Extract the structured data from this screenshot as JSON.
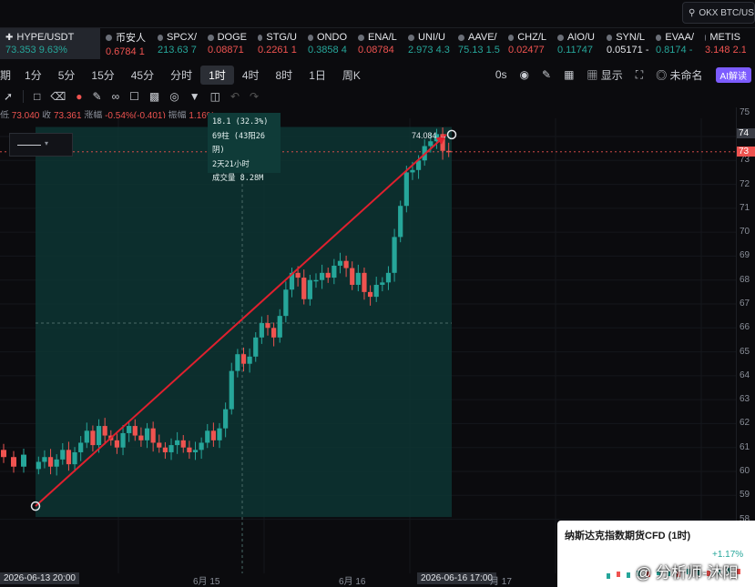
{
  "search": {
    "text": "OKX BTC/USDT"
  },
  "main_ticker": {
    "name": "HYPE/USDT",
    "price": "73.353",
    "change": "9.63%"
  },
  "tickers": [
    {
      "name": "币安人",
      "price": "0.6784",
      "change": "1",
      "dir": "dn"
    },
    {
      "name": "SPCX/",
      "price": "213.63",
      "change": "7",
      "dir": "up"
    },
    {
      "name": "DOGE",
      "price": "0.08871",
      "change": "",
      "dir": "dn"
    },
    {
      "name": "STG/U",
      "price": "0.2261",
      "change": "1",
      "dir": "dn"
    },
    {
      "name": "ONDO",
      "price": "0.3858",
      "change": "4",
      "dir": "up"
    },
    {
      "name": "ENA/L",
      "price": "0.08784",
      "change": "",
      "dir": "dn"
    },
    {
      "name": "UNI/U",
      "price": "2.973",
      "change": "4.3",
      "dir": "up"
    },
    {
      "name": "AAVE/",
      "price": "75.13",
      "change": "1.5",
      "dir": "up"
    },
    {
      "name": "CHZ/L",
      "price": "0.02477",
      "change": "",
      "dir": "dn"
    },
    {
      "name": "AIO/U",
      "price": "0.11747",
      "change": "",
      "dir": "up"
    },
    {
      "name": "SYN/L",
      "price": "0.05171",
      "change": "-",
      "dir": "neutral"
    },
    {
      "name": "EVAA/",
      "price": "0.8174",
      "change": "-",
      "dir": "up"
    },
    {
      "name": "METIS",
      "price": "3.148",
      "change": "2.1",
      "dir": "dn"
    }
  ],
  "intervals": {
    "cut": "期",
    "items": [
      "1分",
      "5分",
      "15分",
      "45分",
      "分时",
      "1时",
      "4时",
      "8时",
      "1日",
      "周K"
    ],
    "active": "1时"
  },
  "toolbar_right": {
    "zero": "0s",
    "show": "显示",
    "unnamed": "未命名",
    "ai": "AI解读"
  },
  "ohlc": {
    "low_label": "低",
    "low": "73.040",
    "close_label": "收",
    "close": "73.361",
    "chg_label": "涨幅",
    "chg": "-0.54%(-0.401)",
    "amp_label": "振幅",
    "amp": "1.16%"
  },
  "measure": {
    "line1": "18.1 (32.3%)",
    "line2": "69柱 (43阳26阴)",
    "line3": "2天21小时",
    "line4": "成交量 8.28M",
    "end_price": "74.084"
  },
  "x_axis": {
    "start": "2026-06-13 20:00",
    "t1": "6月 15",
    "t2": "6月 16",
    "end": "2026-06-16 17:00",
    "t3": "月 17"
  },
  "y_axis": {
    "ticks": [
      "75",
      "74",
      "73",
      "72",
      "71",
      "70",
      "69",
      "68",
      "67",
      "66",
      "65",
      "64",
      "63",
      "62",
      "61",
      "60",
      "59",
      "58"
    ],
    "price_tag_1": "74",
    "price_tag_2": "73"
  },
  "mini_panel": {
    "title": "纳斯达克指数期货CFD (1时)",
    "change": "+1.17%",
    "watermark": "@ 分析师-沐阳"
  },
  "colors": {
    "up": "#26a69a",
    "down": "#ef5350",
    "band": "#0d3532",
    "arrow": "#e0202e",
    "accent": "#7c5cff"
  },
  "chart_data": {
    "type": "candlestick",
    "interval": "1时",
    "ylim": [
      58,
      75.5
    ],
    "closes": [
      60.4,
      60.6,
      60.2,
      60.5,
      60.9,
      60.3,
      60.8,
      61.2,
      61.7,
      61.1,
      61.9,
      61.5,
      61.3,
      61.0,
      61.6,
      61.9,
      61.5,
      61.3,
      61.8,
      61.2,
      61.0,
      60.8,
      61.1,
      61.3,
      61.0,
      60.8,
      60.9,
      61.2,
      61.7,
      61.3,
      61.8,
      62.6,
      64.2,
      64.9,
      64.5,
      64.8,
      65.6,
      66.2,
      66.0,
      65.6,
      66.5,
      67.6,
      68.3,
      68.1,
      67.2,
      68.0,
      68.0,
      68.3,
      68.1,
      68.6,
      68.8,
      68.5,
      67.8,
      68.3,
      67.5,
      67.3,
      67.8,
      67.9,
      68.3,
      69.8,
      71.1,
      72.5,
      72.6,
      73.0,
      73.6,
      73.8,
      74.1,
      73.4,
      73.36
    ],
    "start_label": "2026-06-13 20:00",
    "end_label": "2026-06-16 17:00",
    "bars": 69,
    "up_bars": 43,
    "down_bars": 26,
    "change": "18.1 (32.3%)",
    "volume": "8.28M"
  }
}
